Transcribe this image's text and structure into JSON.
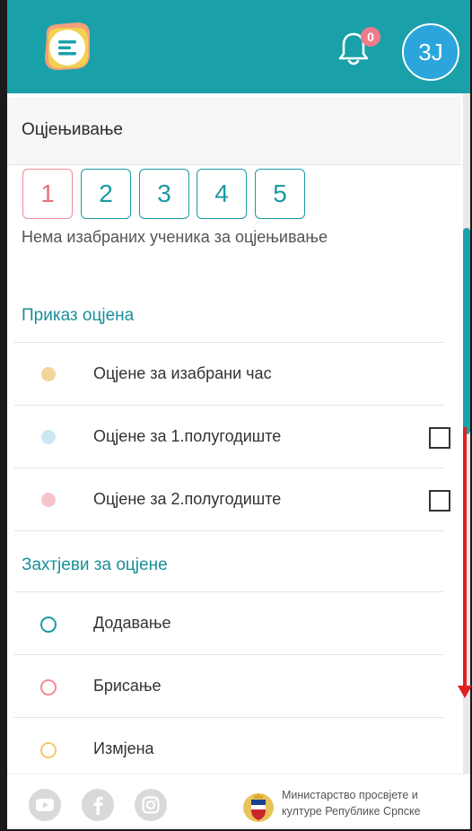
{
  "header": {
    "notification_count": "0",
    "avatar_initials": "3J",
    "accent_color": "#1aa0a8",
    "icons": [
      "menu-logo-icon",
      "bell-icon"
    ]
  },
  "grading": {
    "title": "Оцјењивање",
    "grades": [
      "1",
      "2",
      "3",
      "4",
      "5"
    ],
    "empty_message": "Нема изабраних ученика за оцјењивање"
  },
  "grade_display": {
    "title": "Приказ оцјена",
    "items": [
      {
        "label": "Оцјене за изабрани час",
        "color": "#f3d49a",
        "has_checkbox": false
      },
      {
        "label": "Оцјене за 1.полугодиште",
        "color": "#cbe8f1",
        "has_checkbox": true,
        "checked": false
      },
      {
        "label": "Оцјене за 2.полугодиште",
        "color": "#f6c5cb",
        "has_checkbox": true,
        "checked": false
      }
    ]
  },
  "grade_requests": {
    "title": "Захтјеви за оцјене",
    "items": [
      {
        "label": "Додавање",
        "color": "#1a9aa3"
      },
      {
        "label": "Брисање",
        "color": "#f08a96"
      },
      {
        "label": "Измјена",
        "color": "#f2c86a"
      }
    ]
  },
  "footer": {
    "social_icons": [
      "youtube-icon",
      "facebook-icon",
      "instagram-icon"
    ],
    "ministry_line1": "Министарство просвјете и",
    "ministry_line2": "културе Републике Српске"
  }
}
